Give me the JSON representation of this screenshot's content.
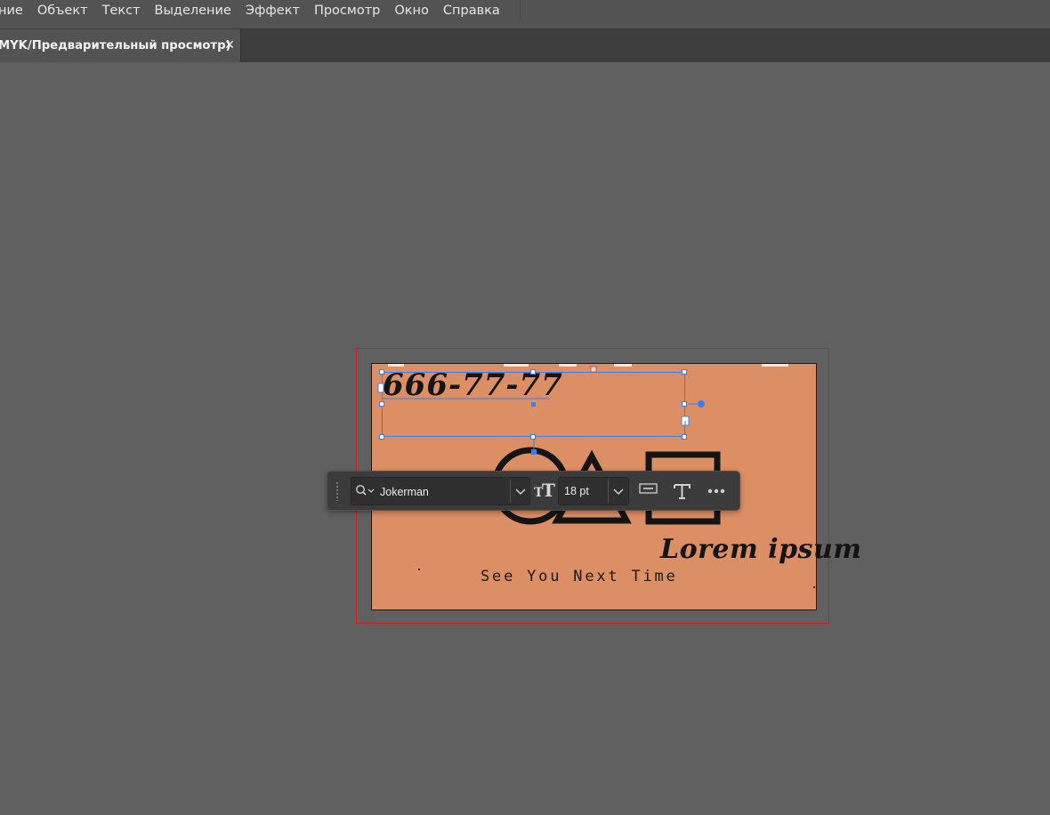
{
  "menu": {
    "items": [
      "ние",
      "Объект",
      "Текст",
      "Выделение",
      "Эффект",
      "Просмотр",
      "Окно",
      "Справка"
    ]
  },
  "document_tab": {
    "title": "MYK/Предварительный просмотр)",
    "close": "✕"
  },
  "artboard": {
    "background_color": "#dc8e64",
    "phone": "666-77-77",
    "tagline": "See You Next Time",
    "lorem": "Lorem ipsum"
  },
  "context_bar": {
    "font_name": "Jokerman",
    "font_size": "18 pt",
    "icons": [
      "search-icon",
      "chevron-down-icon",
      "font-size-icon",
      "chevron-down-icon",
      "area-type-icon",
      "type-tool-icon",
      "more-options-icon"
    ]
  },
  "colors": {
    "selection": "#3b7cf0",
    "bleed": "#d11c1c"
  }
}
